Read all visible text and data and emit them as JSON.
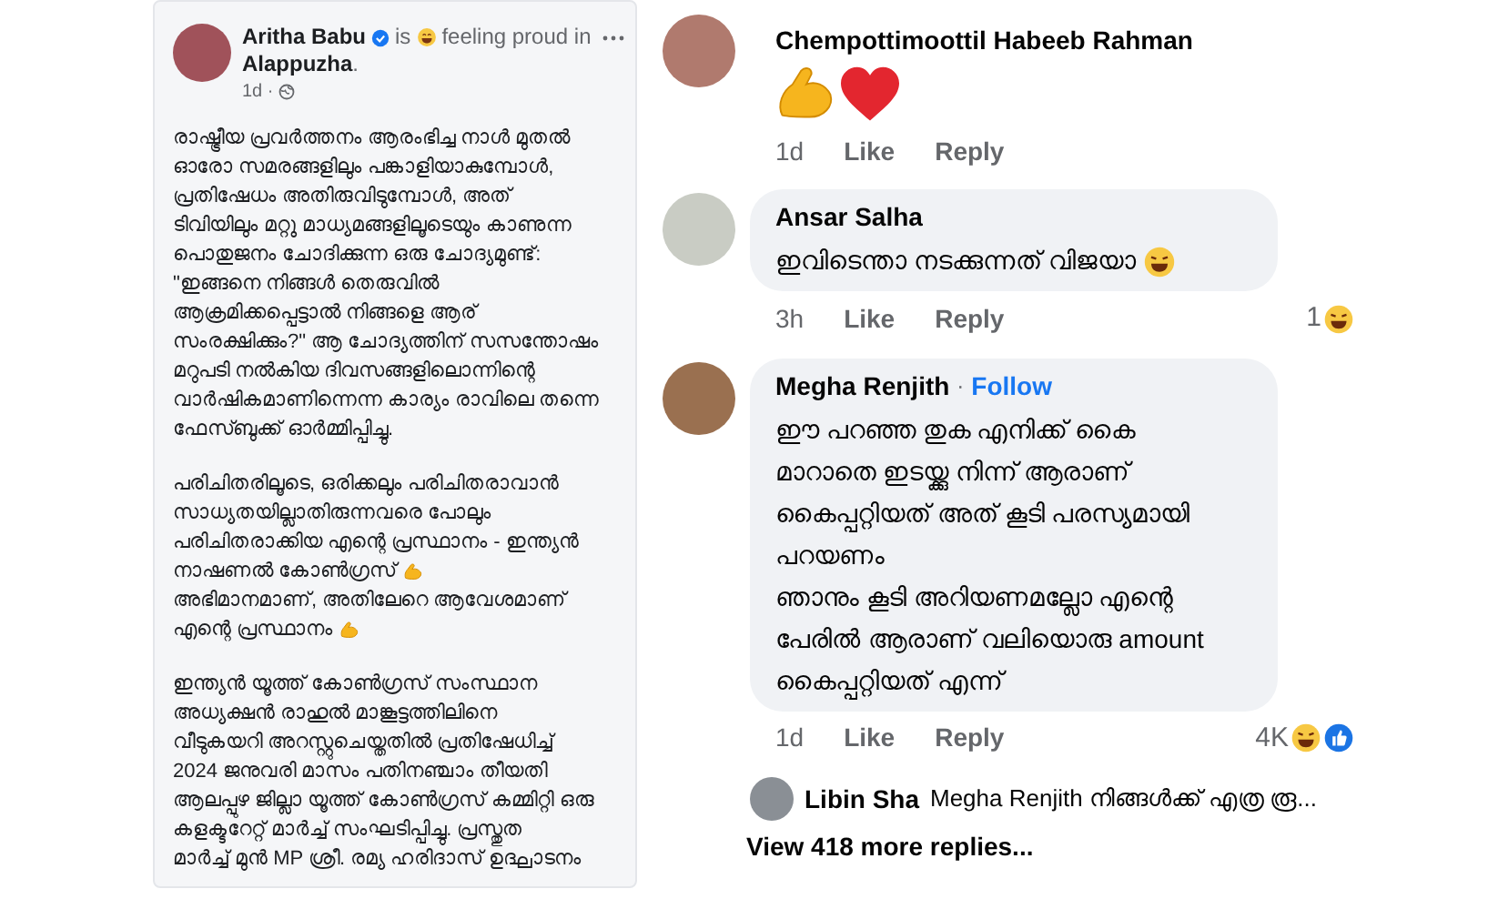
{
  "post": {
    "author": "Aritha Babu",
    "is": "is",
    "feeling": "feeling proud in",
    "place": "Alappuzha",
    "period": ".",
    "time": "1d ·",
    "paragraphs": [
      {
        "lines": [
          {
            "text": "രാഷ്ട്രീയ പ്രവർത്തനം ആരംഭിച്ച നാൾ മുതൽ",
            "kind": "plain"
          },
          {
            "text": "ഓരോ സമരങ്ങളിലും പങ്കാളിയാകുമ്പോൾ,",
            "kind": "plain"
          },
          {
            "text": "പ്രതിഷേധം അതിരുവിടുമ്പോൾ, അത്",
            "kind": "plain"
          },
          {
            "text": "ടിവിയിലും മറ്റു മാധ്യമങ്ങളിലൂടെയും കാണുന്ന",
            "kind": "plain"
          },
          {
            "text": "പൊതുജനം ചോദിക്കുന്ന ഒരു ചോദ്യമുണ്ട്:",
            "kind": "plain"
          },
          {
            "text": "\"ഇങ്ങനെ നിങ്ങൾ തെരുവിൽ",
            "kind": "plain"
          },
          {
            "text": "ആക്രമിക്കപ്പെട്ടാൽ നിങ്ങളെ ആര്",
            "kind": "plain"
          },
          {
            "text": "സംരക്ഷിക്കും?\" ആ ചോദ്യത്തിന് സസന്തോഷം",
            "kind": "plain"
          },
          {
            "text": "മറുപടി നൽകിയ ദിവസങ്ങളിലൊന്നിന്റെ",
            "kind": "plain"
          },
          {
            "text": "വാർഷികമാണിന്നെന്ന കാര്യം രാവിലെ തന്നെ",
            "kind": "plain"
          },
          {
            "text": "ഫേസ്ബുക്ക് ഓർമ്മിപ്പിച്ചു.",
            "kind": "plain"
          }
        ]
      },
      {
        "lines": [
          {
            "text": "പരിചിതരിലൂടെ, ഒരിക്കലും പരിചിതരാവാൻ",
            "kind": "plain"
          },
          {
            "text": "സാധ്യതയില്ലാതിരുന്നവരെ പോലും",
            "kind": "plain"
          },
          {
            "text": "പരിചിതരാക്കിയ എന്റെ പ്രസ്ഥാനം - ഇന്ത്യൻ",
            "kind": "plain"
          },
          {
            "text": "നാഷണൽ കോൺഗ്രസ്",
            "kind": "arm"
          },
          {
            "text": "അഭിമാനമാണ്, അതിലേറെ ആവേശമാണ്",
            "kind": "plain"
          },
          {
            "text": "എന്റെ പ്രസ്ഥാനം",
            "kind": "arm"
          }
        ]
      },
      {
        "lines": [
          {
            "text": "ഇന്ത്യൻ യൂത്ത് കോൺഗ്രസ് സംസ്ഥാന",
            "kind": "plain"
          },
          {
            "text": "അധ്യക്ഷൻ രാഹുൽ മാങ്കൂട്ടത്തിലിനെ",
            "kind": "plain"
          },
          {
            "text": "വീടുകയറി അറസ്റ്റുചെയ്തതിൽ പ്രതിഷേധിച്ച്",
            "kind": "plain"
          },
          {
            "text": "2024 ജനുവരി മാസം പതിനഞ്ചാം തീയതി",
            "kind": "plain"
          },
          {
            "text": "ആലപ്പുഴ ജില്ലാ യൂത്ത് കോൺഗ്രസ് കമ്മിറ്റി ഒരു",
            "kind": "plain"
          },
          {
            "text": "കളക്ടറേറ്റ് മാർച്ച് സംഘടിപ്പിച്ചു. പ്രസ്തുത",
            "kind": "plain"
          },
          {
            "text": "മാർച്ച് മുൻ MP ശ്രീ. രമ്യ ഹരിദാസ് ഉദ്ഘാടനം",
            "kind": "plain"
          }
        ]
      }
    ]
  },
  "comments": [
    {
      "author": "Chempottimoottil Habeeb Rahman",
      "kind": "emoji",
      "bubble": false,
      "time": "1d",
      "like": "Like",
      "reply": "Reply"
    },
    {
      "author": "Ansar Salha",
      "kind": "text",
      "bubble": true,
      "lines": [
        "ഇവിടെന്താ നടക്കുന്നത് വിജയാ"
      ],
      "smile": true,
      "time": "3h",
      "like": "Like",
      "reply": "Reply",
      "reactions": "1",
      "reaction_icons": [
        {
          "kind": "laugh"
        }
      ]
    },
    {
      "author": "Megha Renjith",
      "separator": "·",
      "follow": "Follow",
      "kind": "text",
      "bubble": true,
      "lines": [
        "ഈ പറഞ്ഞ തുക എനിക്ക് കൈ",
        "മാറാതെ ഇടയ്ക്കു നിന്ന് ആരാണ്",
        "കൈപ്പറ്റിയത് അത് കൂടി പരസ്യമായി",
        "പറയണം",
        "ഞാനും കൂടി അറിയണമല്ലോ എന്റെ",
        "പേരിൽ ആരാണ് വലിയൊരു amount",
        "കൈപ്പറ്റിയത് എന്ന്"
      ],
      "time": "1d",
      "like": "Like",
      "reply": "Reply",
      "reactions": "4K",
      "reaction_icons": [
        {
          "kind": "laugh"
        },
        {
          "kind": "like"
        }
      ],
      "replies": {
        "author": "Libin Sha",
        "text": "Megha Renjith നിങ്ങൾക്ക് എത്ര രൂ...",
        "more": "View 418 more replies..."
      }
    }
  ]
}
